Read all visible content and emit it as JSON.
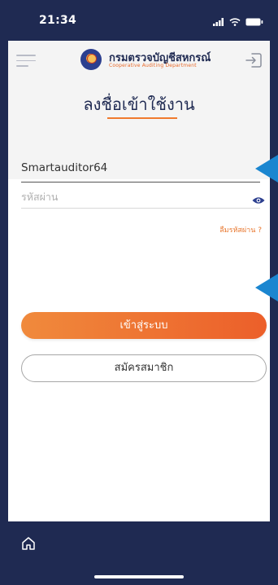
{
  "status_bar": {
    "time": "21:34",
    "signal": "signal-icon",
    "wifi": "wifi-icon",
    "battery": "battery-icon"
  },
  "header": {
    "menu_icon": "hamburger-menu-icon",
    "org_name": "กรมตรวจบัญชีสหกรณ์",
    "org_subtitle": "Cooperative Auditing Department",
    "logout_icon": "logout-icon"
  },
  "page": {
    "title": "ลงชื่อเข้าใช้งาน"
  },
  "form": {
    "username_value": "Smartauditor64",
    "password_placeholder": "รหัสผ่าน",
    "forgot_password": "ลืมรหัสผ่าน ?",
    "login_button": "เข้าสู่ระบบ",
    "register_button": "สมัครสมาชิก"
  },
  "bottom_nav": {
    "home_icon": "home-icon"
  },
  "colors": {
    "navy": "#1f2a52",
    "accent_orange": "#ec6a2c",
    "annotation_blue": "#1b86d0"
  }
}
